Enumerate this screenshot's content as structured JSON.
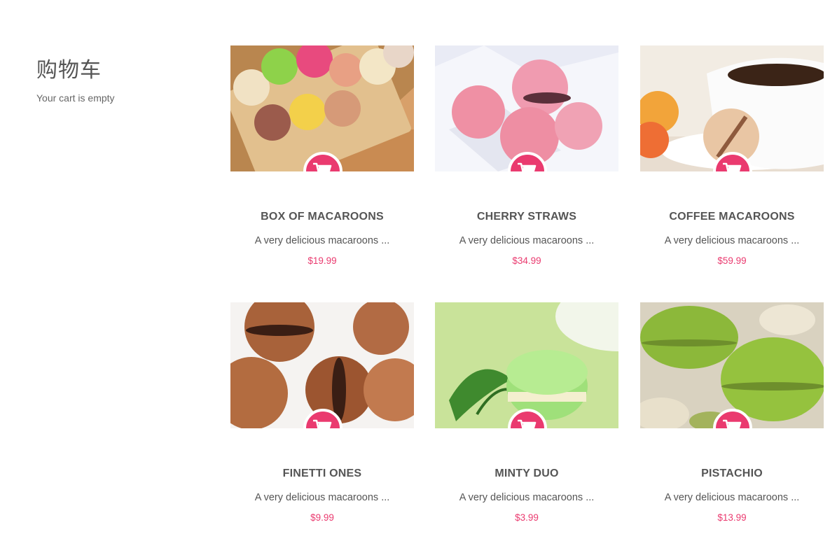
{
  "cart": {
    "title": "购物车",
    "status": "Your cart is empty"
  },
  "products": [
    {
      "name": "BOX OF MACAROONS",
      "description": "A very delicious macaroons ...",
      "price": "$19.99"
    },
    {
      "name": "CHERRY STRAWS",
      "description": "A very delicious macaroons ...",
      "price": "$34.99"
    },
    {
      "name": "COFFEE MACAROONS",
      "description": "A very delicious macaroons ...",
      "price": "$59.99"
    },
    {
      "name": "FINETTI ONES",
      "description": "A very delicious macaroons ...",
      "price": "$9.99"
    },
    {
      "name": "MINTY DUO",
      "description": "A very delicious macaroons ...",
      "price": "$3.99"
    },
    {
      "name": "PISTACHIO",
      "description": "A very delicious macaroons ...",
      "price": "$13.99"
    }
  ],
  "icons": {
    "cart_button": "shopping-cart-icon"
  },
  "colors": {
    "accent": "#ea3a6f",
    "text": "#555555"
  }
}
